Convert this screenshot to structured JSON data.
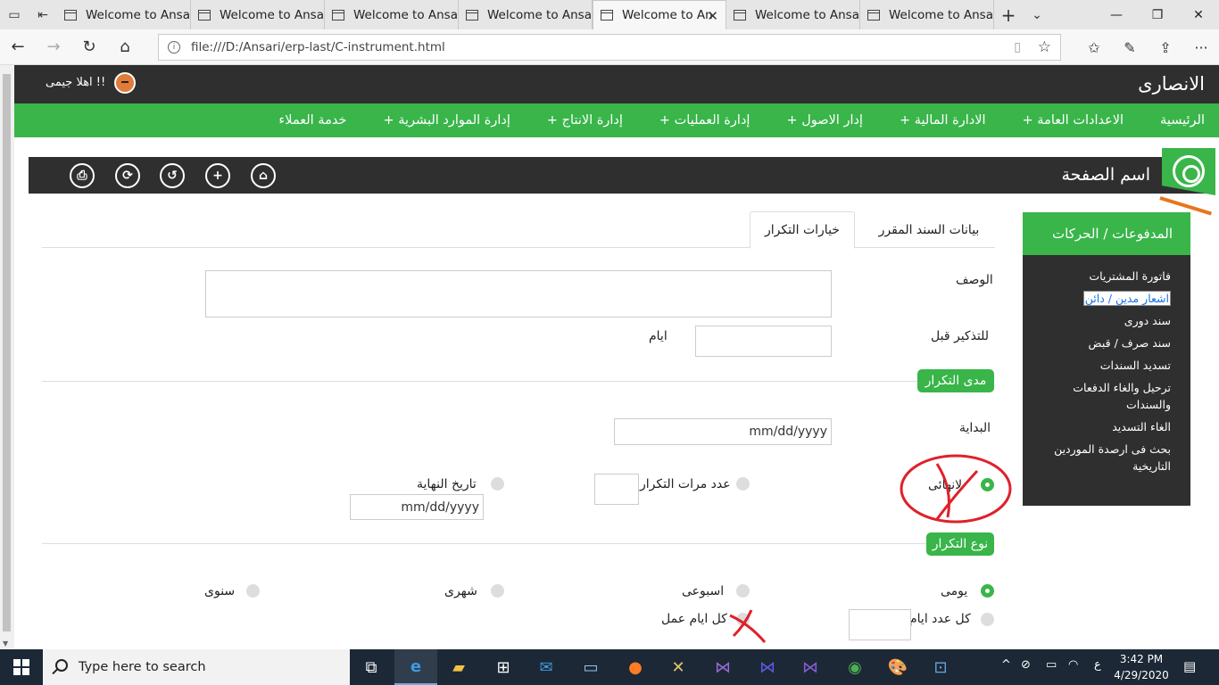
{
  "browser": {
    "tabs": [
      {
        "title": "Welcome to Ansari"
      },
      {
        "title": "Welcome to Ansari"
      },
      {
        "title": "Welcome to Ansari"
      },
      {
        "title": "Welcome to Ansari"
      },
      {
        "title": "Welcome to An",
        "active": true
      },
      {
        "title": "Welcome to Ansari"
      },
      {
        "title": "Welcome to Ansari"
      }
    ],
    "url": "file:///D:/Ansari/erp-last/C-instrument.html"
  },
  "header": {
    "brand": "الانصارى",
    "greeting": "اهلا جيمى !!"
  },
  "menu": {
    "items": [
      "الرئيسية",
      "الاعدادات العامة +",
      "الادارة المالية +",
      "إدار الاصول +",
      "إدارة العمليات +",
      "إدارة الانتاج +",
      "إدارة الموارد البشرية +",
      "خدمة العملاء"
    ]
  },
  "pagebar": {
    "title": "اسم الصفحة",
    "buttons": [
      "home-icon",
      "plus-icon",
      "undo-icon",
      "refresh-icon",
      "print-icon"
    ]
  },
  "sidebar": {
    "heading": "المدفوعات / الحركات",
    "items": [
      "فاتورة المشتريات",
      "اشعار مدين / دائن",
      "سند دورى",
      "سند صرف / قبض",
      "تسديد السندات",
      "ترحيل والغاء الدفعات والسندات",
      "الغاء التسديد",
      "بحث فى ارصدة الموردين التاريخية"
    ],
    "selected_index": 1
  },
  "form": {
    "tabs": {
      "data": "بيانات السند المقرر",
      "recurrence": "خيارات التكرار"
    },
    "description_label": "الوصف",
    "reminder_label": "للتذكير قبل",
    "days_label": "ايام",
    "range_section": "مدى التكرار",
    "start_label": "البداية",
    "date_placeholder": "mm/dd/yyyy",
    "no_end": "لانهائى",
    "occurrences": "عدد مرات التكرار",
    "end_date": "تاريخ النهاية",
    "type_section": "نوع التكرار",
    "daily": "يومى",
    "weekly": "اسبوعى",
    "monthly": "شهرى",
    "yearly": "سنوى",
    "every_n_days": "كل عدد ايام",
    "every_workday": "كل ايام عمل"
  },
  "taskbar": {
    "search_placeholder": "Type here to search",
    "time": "3:42 PM",
    "date": "4/29/2020",
    "lang": "ع"
  },
  "colors": {
    "green": "#39b54a",
    "dark": "#2f2f2f",
    "annotation": "#e0202a"
  }
}
